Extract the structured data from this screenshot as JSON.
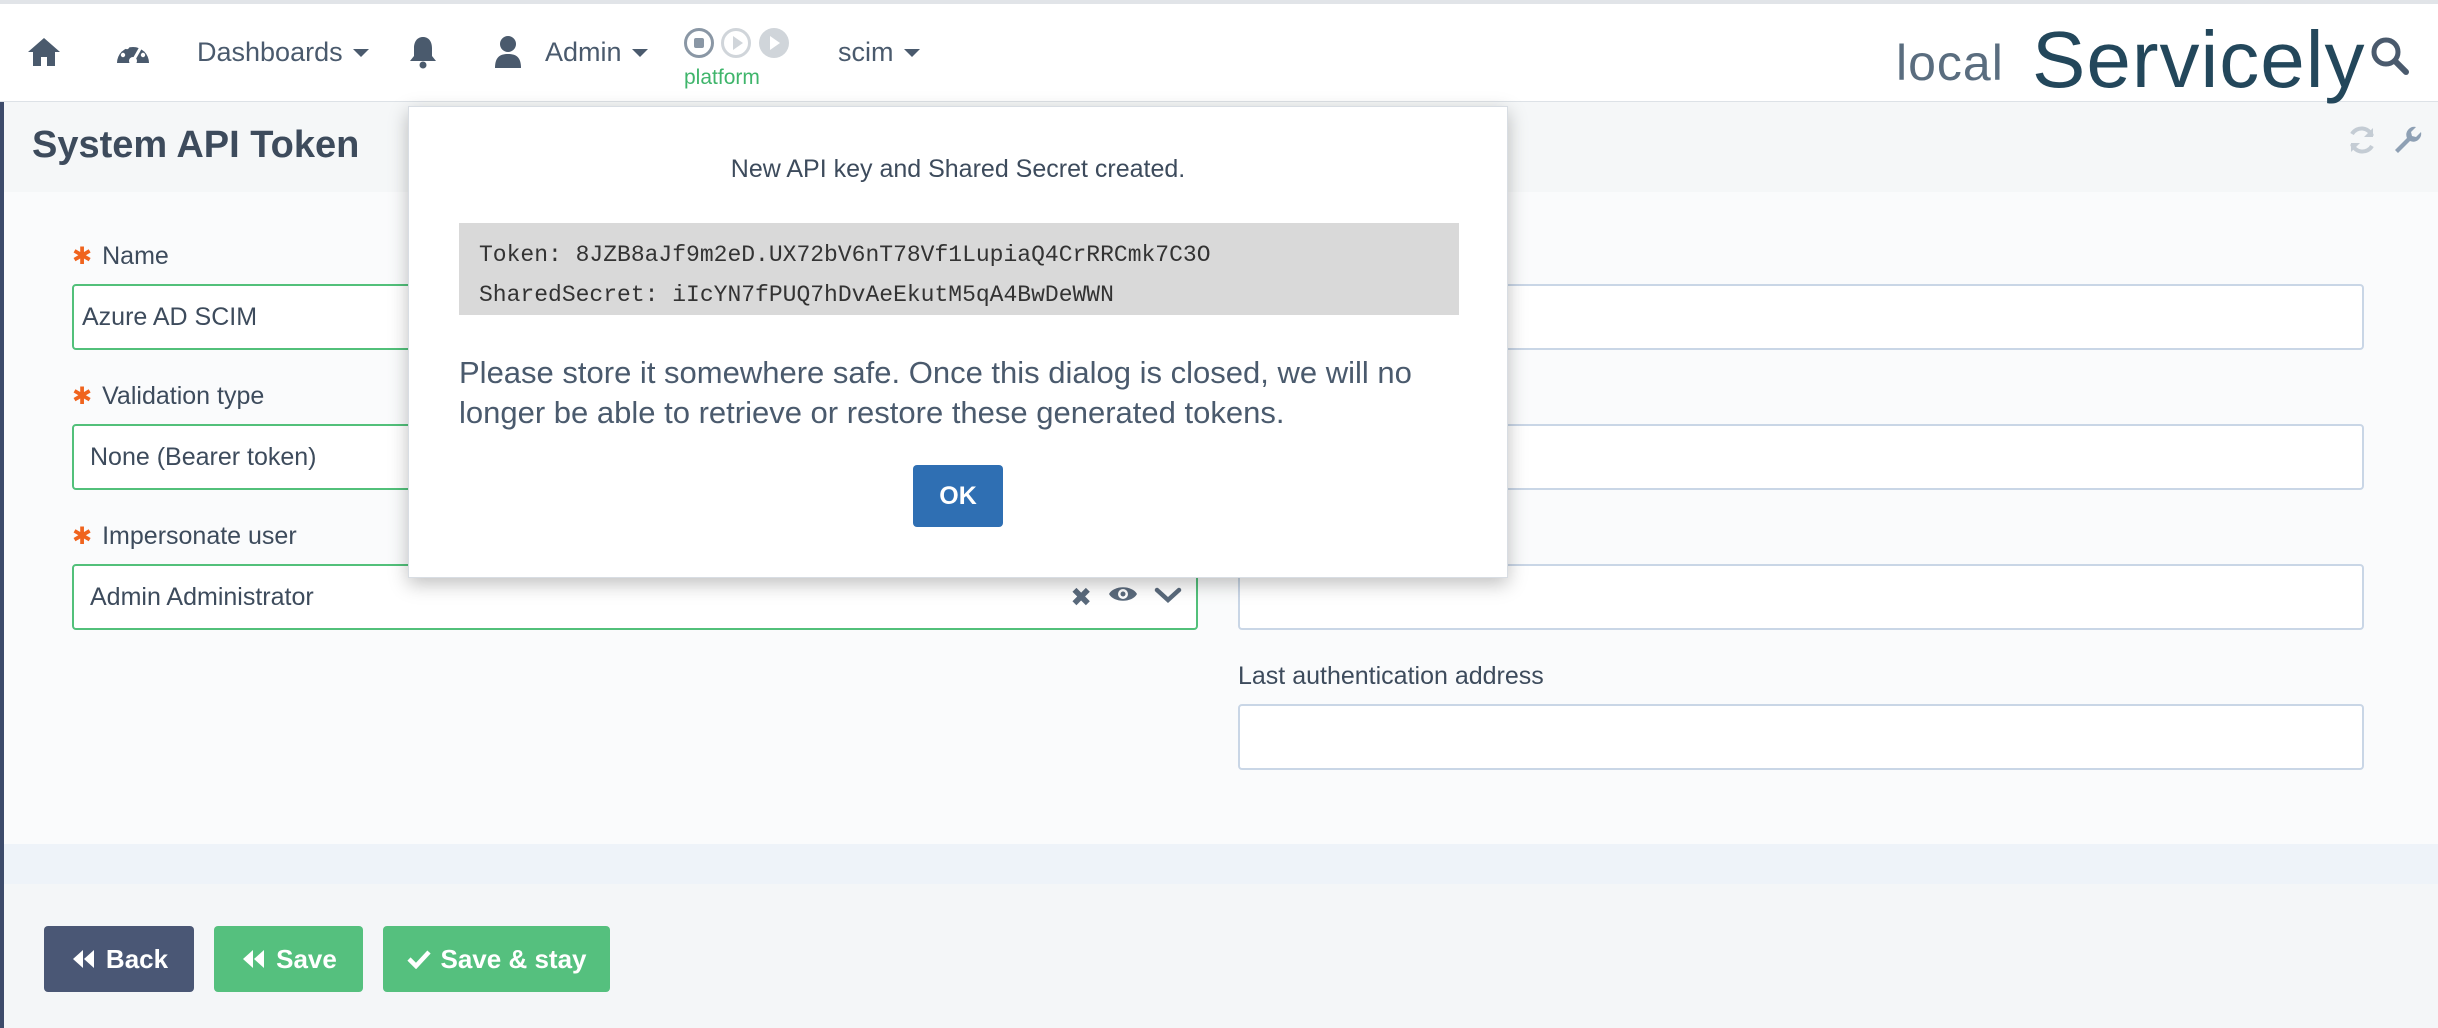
{
  "navbar": {
    "dashboards_label": "Dashboards",
    "admin_label": "Admin",
    "platform_label": "platform",
    "scim_label": "scim",
    "environment": "local",
    "brand": "Servicely"
  },
  "page": {
    "title": "System API Token"
  },
  "form": {
    "name_label": "Name",
    "name_value": "Azure AD SCIM",
    "validation_label": "Validation type",
    "validation_value": "None (Bearer token)",
    "impersonate_label": "Impersonate user",
    "impersonate_value": "Admin Administrator",
    "last_auth_label": "Last authentication address",
    "last_auth_value": ""
  },
  "buttons": {
    "back": "Back",
    "save": "Save",
    "save_stay": "Save & stay"
  },
  "modal": {
    "heading": "New API key and Shared Secret created.",
    "token_line": "Token: 8JZB8aJf9m2eD.UX72bV6nT78Vf1LupiaQ4CrRRCmk7C3O",
    "secret_line": "SharedSecret: iIcYN7fPUQ7hDvAeEkutM5qA4BwDeWWN",
    "message": "Please store it somewhere safe. Once this dialog is closed, we will no longer be able to retrieve or restore these generated tokens.",
    "ok_label": "OK"
  },
  "icons": {
    "home": "home-icon",
    "dashboard": "gauge-icon",
    "bell": "bell-icon",
    "user": "user-icon",
    "stop": "stop-icon",
    "play": "play-icon",
    "search": "search-icon",
    "refresh": "refresh-icon",
    "wrench": "wrench-icon"
  },
  "colors": {
    "primary_green": "#55c07e",
    "back_button": "#4a5775",
    "ok_button": "#2f6fb3",
    "required_asterisk": "#f0641e",
    "brand_text": "#23475b"
  }
}
